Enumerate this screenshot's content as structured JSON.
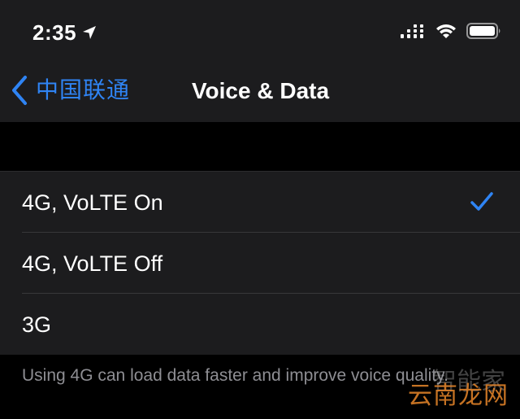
{
  "status_bar": {
    "time": "2:35"
  },
  "nav": {
    "back_label": "中国联通",
    "title": "Voice & Data"
  },
  "options": [
    {
      "label": "4G, VoLTE On",
      "selected": true
    },
    {
      "label": "4G, VoLTE Off",
      "selected": false
    },
    {
      "label": "3G",
      "selected": false
    }
  ],
  "footer": {
    "text": "Using 4G can load data faster and improve voice quality."
  },
  "watermark": {
    "text": "云南龙网",
    "faint_text": "智能家"
  },
  "colors": {
    "accent": "#2f84f4",
    "background": "#000000",
    "group_background": "#1c1c1e",
    "secondary_text": "#8e8e93"
  },
  "icons": [
    "location-arrow-icon",
    "cellular-signal-icon",
    "wifi-icon",
    "battery-icon",
    "chevron-left-icon",
    "checkmark-icon"
  ]
}
